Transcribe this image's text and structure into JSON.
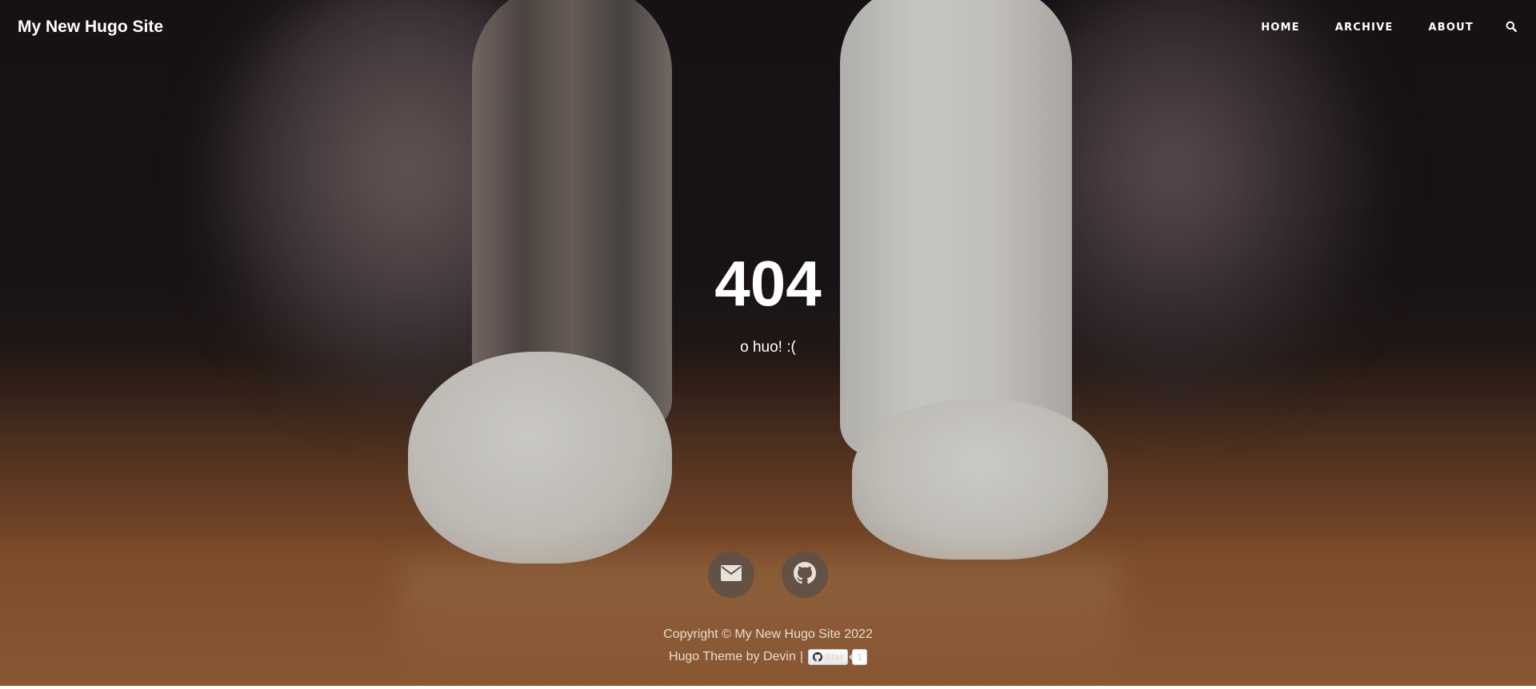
{
  "site": {
    "brand": "My New Hugo Site"
  },
  "nav": {
    "items": [
      {
        "label": "HOME"
      },
      {
        "label": "ARCHIVE"
      },
      {
        "label": "ABOUT"
      }
    ],
    "search_icon": "search-icon"
  },
  "main": {
    "heading": "404",
    "subheading": "o huo! :("
  },
  "social": {
    "items": [
      {
        "icon": "envelope-icon"
      },
      {
        "icon": "github-icon"
      }
    ]
  },
  "footer": {
    "copyright": "Copyright © My New Hugo Site 2022",
    "credit_prefix": "Hugo Theme by",
    "credit_author": "Devin",
    "separator": "|",
    "star_label": "Star",
    "star_count": "1"
  },
  "colors": {
    "text": "#ffffff",
    "social_button_bg": "#5f5048",
    "footer_text": "#e9dccd"
  }
}
